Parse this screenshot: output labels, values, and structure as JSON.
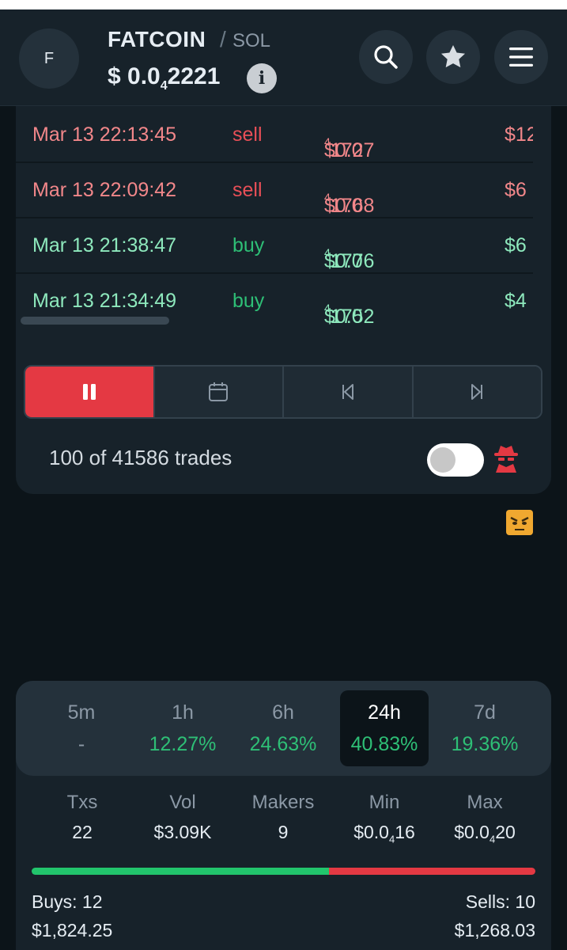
{
  "token": {
    "avatar_letter": "F",
    "name": "FATCOIN",
    "separator": "/",
    "chain": "SOL",
    "price_prefix": "$ 0.0",
    "price_zeros": "4",
    "price_digits": "2221",
    "info_icon": "i"
  },
  "trades": [
    {
      "time": "Mar 13 22:13:45",
      "type": "sell",
      "price_prefix": "$0.0",
      "price_zeros": "4",
      "price_digits": "1727",
      "usd": "$12"
    },
    {
      "time": "Mar 13 22:09:42",
      "type": "sell",
      "price_prefix": "$0.0",
      "price_zeros": "4",
      "price_digits": "1768",
      "usd": "$6"
    },
    {
      "time": "Mar 13 21:38:47",
      "type": "buy",
      "price_prefix": "$0.0",
      "price_zeros": "4",
      "price_digits": "1776",
      "usd": "$6"
    },
    {
      "time": "Mar 13 21:34:49",
      "type": "buy",
      "price_prefix": "$0.0",
      "price_zeros": "4",
      "price_digits": "1752",
      "usd": "$4"
    }
  ],
  "controls": {
    "icons": [
      "pause-icon",
      "calendar-icon",
      "skip-back-icon",
      "skip-forward-icon"
    ]
  },
  "trades_count": "100 of 41586 trades",
  "timeframes": [
    {
      "label": "5m",
      "value": "-"
    },
    {
      "label": "1h",
      "value": "12.27%"
    },
    {
      "label": "6h",
      "value": "24.63%"
    },
    {
      "label": "24h",
      "value": "40.83%"
    },
    {
      "label": "7d",
      "value": "19.36%"
    }
  ],
  "active_timeframe": "24h",
  "stats": {
    "txs": {
      "label": "Txs",
      "value": "22"
    },
    "vol": {
      "label": "Vol",
      "value": "$3.09K"
    },
    "makers": {
      "label": "Makers",
      "value": "9"
    },
    "min": {
      "label": "Min",
      "prefix": "$0.0",
      "zeros": "4",
      "digits": "16"
    },
    "max": {
      "label": "Max",
      "prefix": "$0.0",
      "zeros": "4",
      "digits": "20"
    }
  },
  "buys": {
    "label": "Buys: 12",
    "amount": "$1,824.25",
    "ratio": 0.59
  },
  "sells": {
    "label": "Sells: 10",
    "amount": "$1,268.03"
  },
  "colors": {
    "buy": "#2ebf76",
    "sell": "#e84f57",
    "accent": "#e43943"
  }
}
